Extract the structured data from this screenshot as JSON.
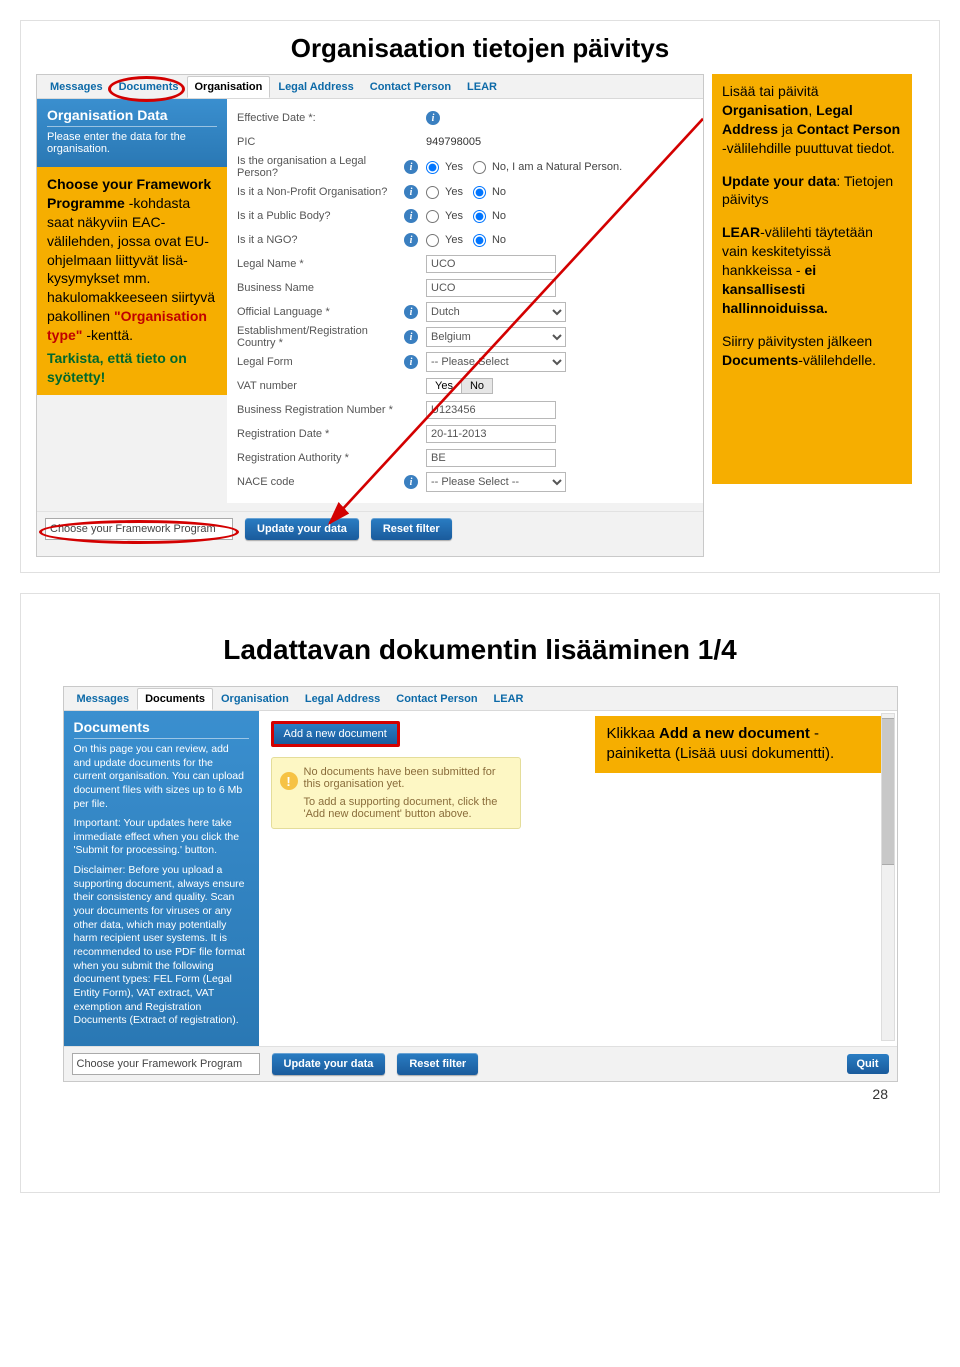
{
  "slide1": {
    "title": "Organisaation tietojen päivitys",
    "tabs": [
      "Messages",
      "Documents",
      "Organisation",
      "Legal Address",
      "Contact Person",
      "LEAR"
    ],
    "active_tab": 2,
    "org_box": {
      "heading": "Organisation Data",
      "desc": "Please enter the data for the organisation."
    },
    "left_note": {
      "p1a": "Choose your Framework Programme",
      "p1b": " -kohdasta saat näkyviin EAC-välilehden, jossa ovat EU-ohjelmaan liittyvät lisä-kysymykset mm. hakulomakkeeseen siirtyvä pakollinen ",
      "p1c": "\"Organisation type\"",
      "p1d": " -kenttä.",
      "p2": "Tarkista, että tieto on syötetty!"
    },
    "form": {
      "effective_date_label": "Effective Date *:",
      "pic_label": "PIC",
      "pic_value": "949798005",
      "legal_person_label": "Is the organisation a Legal Person?",
      "legal_person_yes": "Yes",
      "legal_person_no": "No, I am a Natural Person.",
      "nonprofit_label": "Is it a Non-Profit Organisation?",
      "public_label": "Is it a Public Body?",
      "ngo_label": "Is it a NGO?",
      "yes": "Yes",
      "no": "No",
      "legal_name_label": "Legal Name *",
      "legal_name_value": "UCO",
      "business_name_label": "Business Name",
      "business_name_value": "UCO",
      "official_language_label": "Official Language *",
      "official_language_value": "Dutch",
      "country_label": "Establishment/Registration Country *",
      "country_value": "Belgium",
      "legal_form_label": "Legal Form",
      "legal_form_value": "-- Please Select",
      "vat_number_label": "VAT number",
      "brn_label": "Business Registration Number *",
      "brn_value": "U123456",
      "reg_date_label": "Registration Date *",
      "reg_date_value": "20-11-2013",
      "reg_auth_label": "Registration Authority *",
      "reg_auth_value": "BE",
      "nace_label": "NACE code",
      "nace_value": "-- Please Select --"
    },
    "bottom": {
      "fw_select": "Choose your Framework Program",
      "update_btn": "Update your data",
      "reset_btn": "Reset filter"
    },
    "right_note": {
      "p1a": "Lisää tai päivitä ",
      "p1b": "Organisation",
      "p1c": ", ",
      "p1d": "Legal Address",
      "p1e": " ja ",
      "p1f": "Contact Person",
      "p1g": " -välilehdille puuttuvat tiedot.",
      "p2a": "Update your data",
      "p2b": ": Tietojen päivitys",
      "p3a": "LEAR",
      "p3b": "-välilehti täytetään vain keskitetyissä hankkeissa  - ",
      "p3c": "ei kansallisesti hallinnoiduissa.",
      "p4a": "Siirry päivitysten jälkeen ",
      "p4b": "Documents",
      "p4c": "-välilehdelle."
    }
  },
  "slide2": {
    "title": "Ladattavan dokumentin lisääminen 1/4",
    "tabs": [
      "Messages",
      "Documents",
      "Organisation",
      "Legal Address",
      "Contact Person",
      "LEAR"
    ],
    "active_tab": 1,
    "docs_box": {
      "heading": "Documents",
      "p1": "On this page you can review, add and update documents for the current organisation. You can upload document files with sizes up to 6 Mb per file.",
      "p2": "Important: Your updates here take immediate effect when you click the 'Submit for processing.' button.",
      "p3": "Disclaimer: Before you upload a supporting document, always ensure their consistency and quality. Scan your documents for viruses or any other data, which may potentially harm recipient user systems. It is recommended to use PDF file format when you submit the following document types: FEL Form (Legal Entity Form), VAT extract, VAT exemption and Registration Documents (Extract of registration)."
    },
    "add_btn": "Add a new document",
    "warn": {
      "line1": "No documents have been submitted for this organisation yet.",
      "line2": "To add a supporting document, click the 'Add new document' button above."
    },
    "yellow": {
      "a": "Klikkaa  ",
      "b": "Add a new document",
      "c": " -painiketta (Lisää uusi dokumentti)."
    },
    "bottom": {
      "fw_select": "Choose your Framework Program",
      "update_btn": "Update your data",
      "reset_btn": "Reset filter",
      "quit_btn": "Quit"
    }
  },
  "page_number": "28"
}
